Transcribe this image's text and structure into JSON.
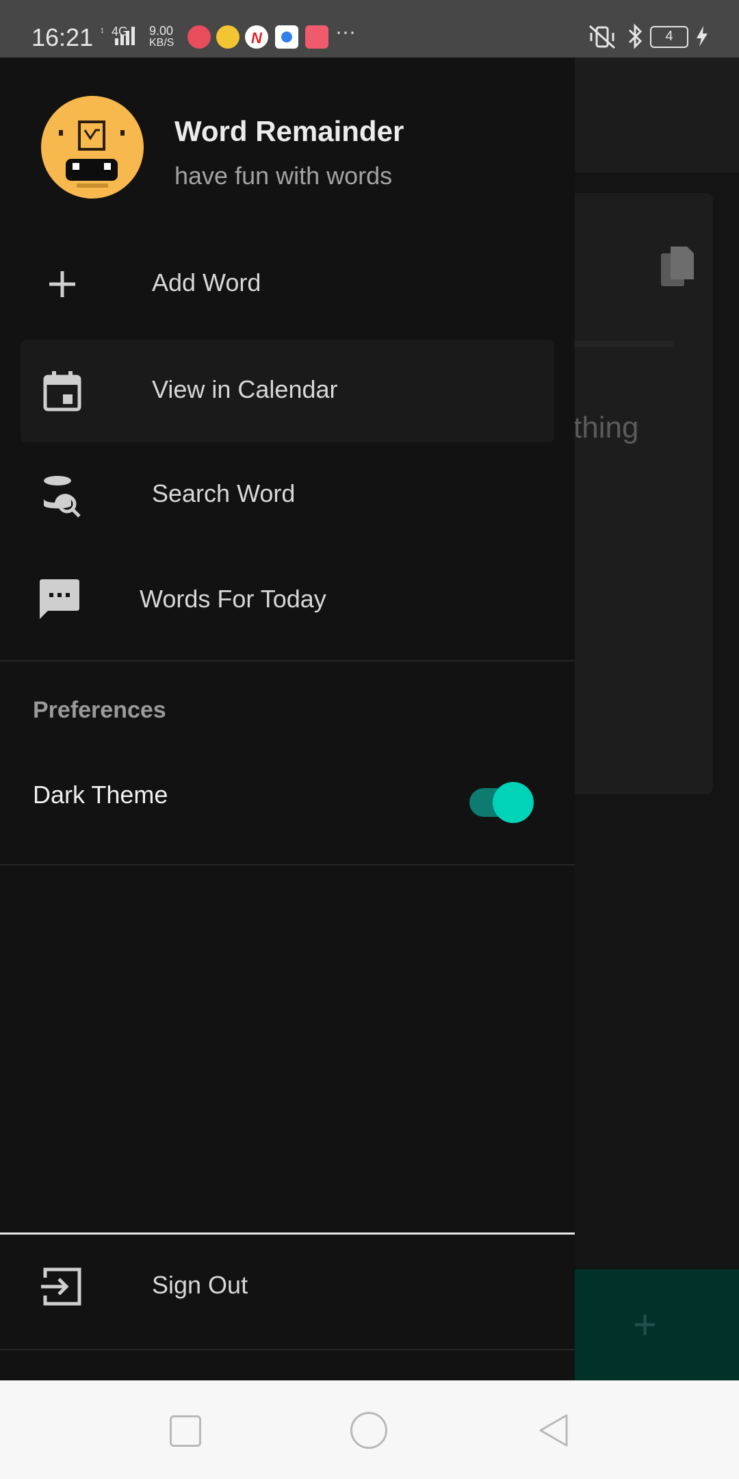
{
  "status_bar": {
    "time": "16:21",
    "network": "4G",
    "speed_value": "9.00",
    "speed_unit": "KB/S",
    "battery": "4",
    "more": "···"
  },
  "background": {
    "partial_text": "thing"
  },
  "drawer": {
    "header": {
      "title": "Word Remainder",
      "subtitle": "have fun with words"
    },
    "items": [
      {
        "label": "Add Word",
        "icon": "plus-icon"
      },
      {
        "label": "View in Calendar",
        "icon": "calendar-icon"
      },
      {
        "label": "Search Word",
        "icon": "database-search-icon"
      },
      {
        "label": "Words For Today",
        "icon": "message-icon"
      }
    ],
    "preferences": {
      "header": "Preferences",
      "dark_theme_label": "Dark Theme",
      "dark_theme_on": true
    },
    "sign_out": {
      "label": "Sign Out",
      "icon": "exit-icon"
    }
  },
  "colors": {
    "drawer_bg": "#121212",
    "accent": "#00d3b8",
    "fab": "#004d40"
  }
}
